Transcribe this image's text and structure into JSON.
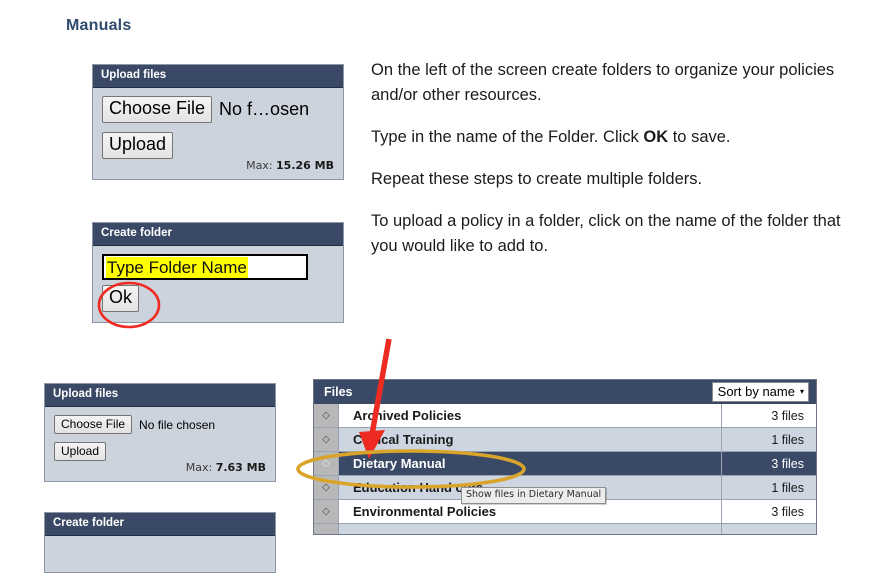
{
  "page": {
    "title": "Manuals"
  },
  "upload_panel_top": {
    "header": "Upload files",
    "choose_button": "Choose File",
    "file_status": "No f…osen",
    "upload_button": "Upload",
    "max_label": "Max:",
    "max_value": "15.26 MB"
  },
  "create_panel_top": {
    "header": "Create folder",
    "input_value": "Type Folder Name",
    "ok_button": "Ok"
  },
  "upload_panel_bottom": {
    "header": "Upload files",
    "choose_button": "Choose File",
    "file_status": "No file chosen",
    "upload_button": "Upload",
    "max_label": "Max:",
    "max_value": "7.63 MB"
  },
  "create_panel_bottom": {
    "header": "Create folder"
  },
  "instructions": [
    {
      "before": "On the left of the screen create folders to organize your policies and/or other resources.",
      "bold": "",
      "after": ""
    },
    {
      "before": "Type in the name of the Folder. Click ",
      "bold": "OK",
      "after": " to save."
    },
    {
      "before": "Repeat these steps to create multiple folders.",
      "bold": "",
      "after": ""
    },
    {
      "before": "To upload a policy in a folder, click on the name of the folder that you would like to add to.",
      "bold": "",
      "after": ""
    }
  ],
  "files_panel": {
    "header": "Files",
    "sort_label": "Sort by name",
    "sort_caret": "▾",
    "handle_icon": "◇",
    "rows": [
      {
        "name": "Archived Policies",
        "count": "3 files",
        "selected": false
      },
      {
        "name": "Clinical Training",
        "count": "1 files",
        "selected": false
      },
      {
        "name": "Dietary Manual",
        "count": "3 files",
        "selected": true
      },
      {
        "name": "Education Hand outs",
        "count": "1 files",
        "selected": false
      },
      {
        "name": "Environmental Policies",
        "count": "3 files",
        "selected": false
      }
    ]
  },
  "tooltip": {
    "text": "Show files in Dietary Manual"
  },
  "colors": {
    "panel_header": "#3a4a66",
    "panel_body": "#ccd3dd",
    "title": "#2f4b6e",
    "row_selected": "#3a4a66",
    "row_alt": "#ccd5e0",
    "annotation_red": "#ee2b22",
    "annotation_gold": "#d9a42a",
    "highlight_yellow": "#ffff00"
  }
}
